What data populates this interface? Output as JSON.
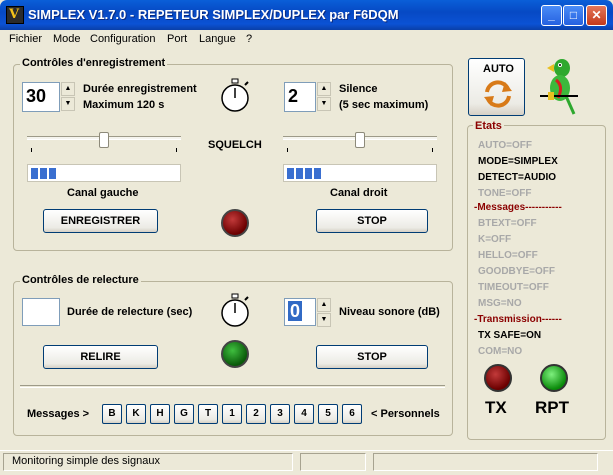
{
  "window": {
    "title": "SIMPLEX V1.7.0 - REPETEUR SIMPLEX/DUPLEX par F6DQM",
    "icon_glyph": "V",
    "minimize_glyph": "_",
    "maximize_glyph": "□",
    "close_glyph": "✕"
  },
  "menu": [
    "Fichier",
    "Mode",
    "Configuration",
    "Port",
    "Langue",
    "?"
  ],
  "recording": {
    "group_title": "Contrôles d'enregistrement",
    "duration_value": "30",
    "duration_label1": "Durée enregistrement",
    "duration_label2": "Maximum 120 s",
    "silence_value": "2",
    "silence_label1": "Silence",
    "silence_label2": "(5 sec maximum)",
    "squelch_label": "SQUELCH",
    "left_channel_label": "Canal gauche",
    "right_channel_label": "Canal droit",
    "left_squelch_level": 0.5,
    "right_squelch_level": 0.5,
    "left_meter_level": 0.2,
    "right_meter_level": 0.27,
    "record_button": "ENREGISTRER",
    "stop_button": "STOP"
  },
  "playback": {
    "group_title": "Contrôles de relecture",
    "duration_value": "",
    "duration_label": "Durée de relecture (sec)",
    "volume_value": "0",
    "volume_label": "Niveau sonore (dB)",
    "replay_button": "RELIRE",
    "stop_button": "STOP"
  },
  "messages": {
    "label": "Messages >",
    "buttons": [
      "B",
      "K",
      "H",
      "G",
      "T",
      "1",
      "2",
      "3",
      "4",
      "5",
      "6"
    ],
    "suffix": "< Personnels"
  },
  "auto_button": "AUTO",
  "states": {
    "title": "Etats",
    "items": [
      {
        "text": "AUTO=OFF",
        "kind": "off"
      },
      {
        "text": "MODE=SIMPLEX",
        "kind": "on"
      },
      {
        "text": "DETECT=AUDIO",
        "kind": "on"
      },
      {
        "text": "TONE=OFF",
        "kind": "off"
      },
      {
        "text": "-Messages-----------",
        "kind": "sect"
      },
      {
        "text": "BTEXT=OFF",
        "kind": "off"
      },
      {
        "text": "K=OFF",
        "kind": "off"
      },
      {
        "text": "HELLO=OFF",
        "kind": "off"
      },
      {
        "text": "GOODBYE=OFF",
        "kind": "off"
      },
      {
        "text": "TIMEOUT=OFF",
        "kind": "off"
      },
      {
        "text": "MSG=NO",
        "kind": "off"
      },
      {
        "text": "-Transmission------",
        "kind": "sect"
      },
      {
        "text": "TX SAFE=ON",
        "kind": "on"
      },
      {
        "text": "COM=NO",
        "kind": "off"
      }
    ],
    "tx_label": "TX",
    "rpt_label": "RPT"
  },
  "statusbar": {
    "text": "Monitoring simple des signaux"
  },
  "colors": {
    "title_bar": "#0649c4",
    "led_red": "#8b0000",
    "led_green": "#22c322",
    "meter_blue": "#3a6fd0"
  }
}
